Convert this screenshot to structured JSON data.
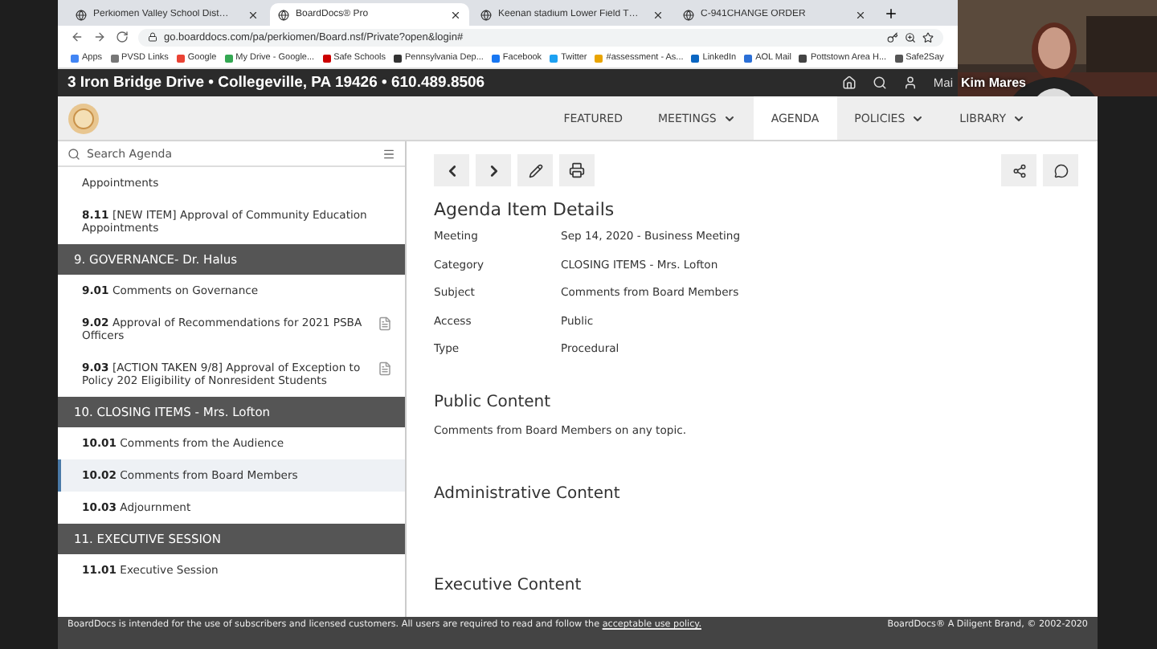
{
  "browser": {
    "tabs": [
      {
        "title": "Perkiomen Valley School Dist…",
        "selected": false
      },
      {
        "title": "BoardDocs® Pro",
        "selected": true
      },
      {
        "title": "Keenan stadium Lower Field T…",
        "selected": false
      },
      {
        "title": "C-941CHANGE ORDER",
        "selected": false
      }
    ],
    "address": "go.boarddocs.com/pa/perkiomen/Board.nsf/Private?open&login#",
    "bookmarks": [
      "Apps",
      "PVSD Links",
      "Google",
      "My Drive - Google...",
      "Safe Schools",
      "Pennsylvania Dep...",
      "Facebook",
      "Twitter",
      "#assessment - As...",
      "LinkedIn",
      "AOL Mail",
      "Pottstown Area H...",
      "Safe2Say"
    ]
  },
  "header": {
    "address_line": "3 Iron Bridge Drive • Collegeville, PA 19426 • 610.489.8506",
    "account_label": "Mai"
  },
  "nav": [
    {
      "label": "FEATURED",
      "selected": false,
      "dropdown": false
    },
    {
      "label": "MEETINGS",
      "selected": false,
      "dropdown": true
    },
    {
      "label": "AGENDA",
      "selected": true,
      "dropdown": false
    },
    {
      "label": "POLICIES",
      "selected": false,
      "dropdown": true
    },
    {
      "label": "LIBRARY",
      "selected": false,
      "dropdown": true
    }
  ],
  "agenda": {
    "search_placeholder": "Search Agenda",
    "items": [
      {
        "kind": "item",
        "text": "Appointments",
        "selected": false,
        "attachment": false
      },
      {
        "kind": "item",
        "text": "**8.11** [NEW ITEM] Approval of Community Education Appointments",
        "selected": false,
        "attachment": false
      },
      {
        "kind": "section",
        "text": "9. GOVERNANCE- Dr. Halus"
      },
      {
        "kind": "item",
        "text": "**9.01** Comments on Governance",
        "selected": false,
        "attachment": false
      },
      {
        "kind": "item",
        "text": "**9.02** Approval of Recommendations for 2021 PSBA Officers",
        "selected": false,
        "attachment": true
      },
      {
        "kind": "item",
        "text": "**9.03** [ACTION TAKEN 9/8] Approval of Exception to Policy 202 Eligibility of Nonresident Students",
        "selected": false,
        "attachment": true
      },
      {
        "kind": "section",
        "text": "10. CLOSING ITEMS - Mrs. Lofton"
      },
      {
        "kind": "item",
        "text": "**10.01** Comments from the Audience",
        "selected": false,
        "attachment": false
      },
      {
        "kind": "item",
        "text": "**10.02** Comments from Board Members",
        "selected": true,
        "attachment": false
      },
      {
        "kind": "item",
        "text": "**10.03** Adjournment",
        "selected": false,
        "attachment": false
      },
      {
        "kind": "section",
        "text": "11. EXECUTIVE SESSION"
      },
      {
        "kind": "item",
        "text": "**11.01** Executive Session",
        "selected": false,
        "attachment": false
      }
    ]
  },
  "details": {
    "title": "Agenda Item Details",
    "fields": [
      {
        "label": "Meeting",
        "value": "Sep 14, 2020 - Business Meeting"
      },
      {
        "label": "Category",
        "value": "CLOSING ITEMS - Mrs. Lofton"
      },
      {
        "label": "Subject",
        "value": "Comments from Board Members"
      },
      {
        "label": "Access",
        "value": "Public"
      },
      {
        "label": "Type",
        "value": "Procedural"
      }
    ],
    "sections": [
      {
        "heading": "Public Content",
        "body": "Comments from Board Members on any topic."
      },
      {
        "heading": "Administrative Content"
      },
      {
        "heading": "Executive Content"
      }
    ]
  },
  "footer": {
    "notice": "BoardDocs is intended for the use of subscribers and licensed customers. All users are required to read and follow the",
    "link": "acceptable use policy.",
    "brand": "BoardDocs® A Diligent Brand, © 2002-2020"
  },
  "video": {
    "name": "Kim Mares"
  }
}
